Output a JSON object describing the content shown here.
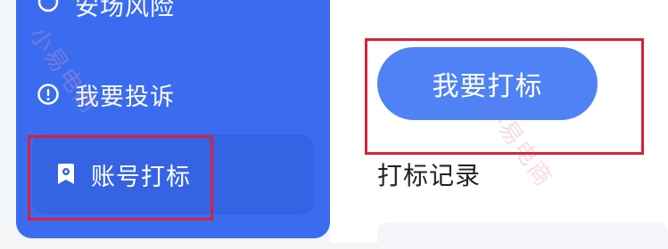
{
  "sidebar": {
    "items": [
      {
        "label": "安场风险",
        "icon": "circle-icon"
      },
      {
        "label": "我要投诉",
        "icon": "exclamation-circle-icon"
      },
      {
        "label": "账号打标",
        "icon": "badge-icon",
        "active": true
      }
    ]
  },
  "main": {
    "primary_button": "我要打标",
    "record_link": "打标记录"
  },
  "watermark": "小易电商",
  "colors": {
    "sidebar_bg": "#3b6cf0",
    "active_item_bg": "#3563e3",
    "button_bg": "#4f83f5",
    "highlight_border": "#d3243a"
  }
}
